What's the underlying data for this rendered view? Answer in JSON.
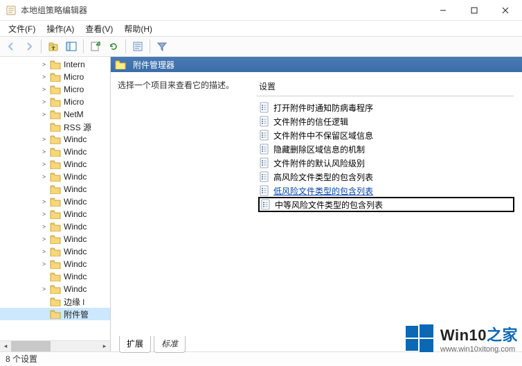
{
  "window": {
    "title": "本地组策略编辑器",
    "minimize": "—",
    "maximize": "□",
    "close": "✕"
  },
  "menubar": [
    "文件(F)",
    "操作(A)",
    "查看(V)",
    "帮助(H)"
  ],
  "tree": {
    "items": [
      {
        "label": "Intern",
        "expand": ">"
      },
      {
        "label": "Micro",
        "expand": ">"
      },
      {
        "label": "Micro",
        "expand": ">"
      },
      {
        "label": "Micro",
        "expand": ">"
      },
      {
        "label": "NetM",
        "expand": ">"
      },
      {
        "label": "RSS 源",
        "expand": ""
      },
      {
        "label": "Windc",
        "expand": ">"
      },
      {
        "label": "Windc",
        "expand": ">"
      },
      {
        "label": "Windc",
        "expand": ">"
      },
      {
        "label": "Windc",
        "expand": ">"
      },
      {
        "label": "Windc",
        "expand": ""
      },
      {
        "label": "Windc",
        "expand": ">"
      },
      {
        "label": "Windc",
        "expand": ">"
      },
      {
        "label": "Windc",
        "expand": ">"
      },
      {
        "label": "Windc",
        "expand": ">"
      },
      {
        "label": "Windc",
        "expand": ">"
      },
      {
        "label": "Windc",
        "expand": ">"
      },
      {
        "label": "Windc",
        "expand": ""
      },
      {
        "label": "Windc",
        "expand": ">"
      },
      {
        "label": "边缘 l",
        "expand": ""
      },
      {
        "label": "附件管",
        "expand": "",
        "selected": true
      }
    ]
  },
  "detail": {
    "header": "附件管理器",
    "description": "选择一个项目来查看它的描述。",
    "column_header": "设置",
    "settings": [
      {
        "label": "打开附件时通知防病毒程序"
      },
      {
        "label": "文件附件的信任逻辑"
      },
      {
        "label": "文件附件中不保留区域信息"
      },
      {
        "label": "隐藏删除区域信息的机制"
      },
      {
        "label": "文件附件的默认风险级别"
      },
      {
        "label": "高风险文件类型的包含列表"
      },
      {
        "label": "低风险文件类型的包含列表",
        "link": true
      },
      {
        "label": "中等风险文件类型的包含列表",
        "highlight": true
      }
    ]
  },
  "tabs": {
    "ext": "扩展",
    "std": "标准"
  },
  "status": "8 个设置",
  "watermark": {
    "title_a": "Win10",
    "title_b": "之家",
    "url": "www.win10xitong.com"
  }
}
